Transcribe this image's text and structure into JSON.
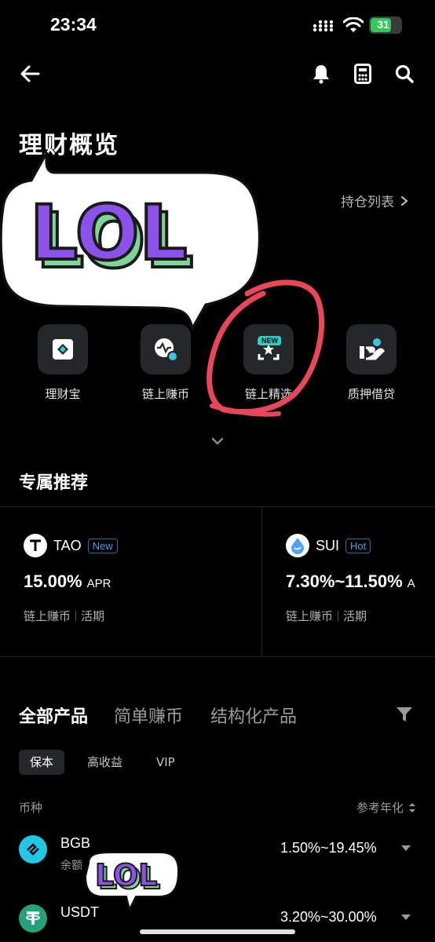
{
  "status_bar": {
    "time": "23:34",
    "battery": "31"
  },
  "nav": {
    "back_icon": "arrow-left-icon",
    "actions": [
      "bell-icon",
      "calculator-icon",
      "search-icon"
    ]
  },
  "page_title": "理财概览",
  "holdings_link": "持仓列表",
  "sticker": {
    "text": "LOL",
    "colors": {
      "fill": "#8a52e8",
      "shadow": "#7fd49a",
      "outline": "#1a1a1a"
    }
  },
  "quick_actions": [
    {
      "label": "理财宝",
      "icon": "vault-icon"
    },
    {
      "label": "链上赚币",
      "icon": "onchain-earn-icon"
    },
    {
      "label": "链上精选",
      "icon": "onchain-select-icon",
      "badge": "NEW"
    },
    {
      "label": "质押借贷",
      "icon": "pledge-loan-icon"
    }
  ],
  "recommend": {
    "title": "专属推荐",
    "cards": [
      {
        "coin": "TAO",
        "tag": "New",
        "rate": "15.00%",
        "unit": "APR",
        "type": "链上赚币",
        "term": "活期"
      },
      {
        "coin": "SUI",
        "tag": "Hot",
        "rate": "7.30%~11.50%",
        "unit": "A",
        "type": "链上赚币",
        "term": "活期"
      }
    ]
  },
  "product_tabs": [
    "全部产品",
    "简单赚币",
    "结构化产品"
  ],
  "chips": [
    "保本",
    "高收益",
    "VIP"
  ],
  "list_header": {
    "left": "币种",
    "right": "参考年化"
  },
  "products": [
    {
      "coin": "BGB",
      "sub": "余额",
      "rate": "1.50%~19.45%"
    },
    {
      "coin": "USDT",
      "sub": "",
      "rate": "3.20%~30.00%"
    }
  ],
  "colors": {
    "accent_badge": "#1fd4c9",
    "tag_blue": "#3ea6e8",
    "annotation_red": "#e8475a",
    "card_bg": "#26272b"
  }
}
